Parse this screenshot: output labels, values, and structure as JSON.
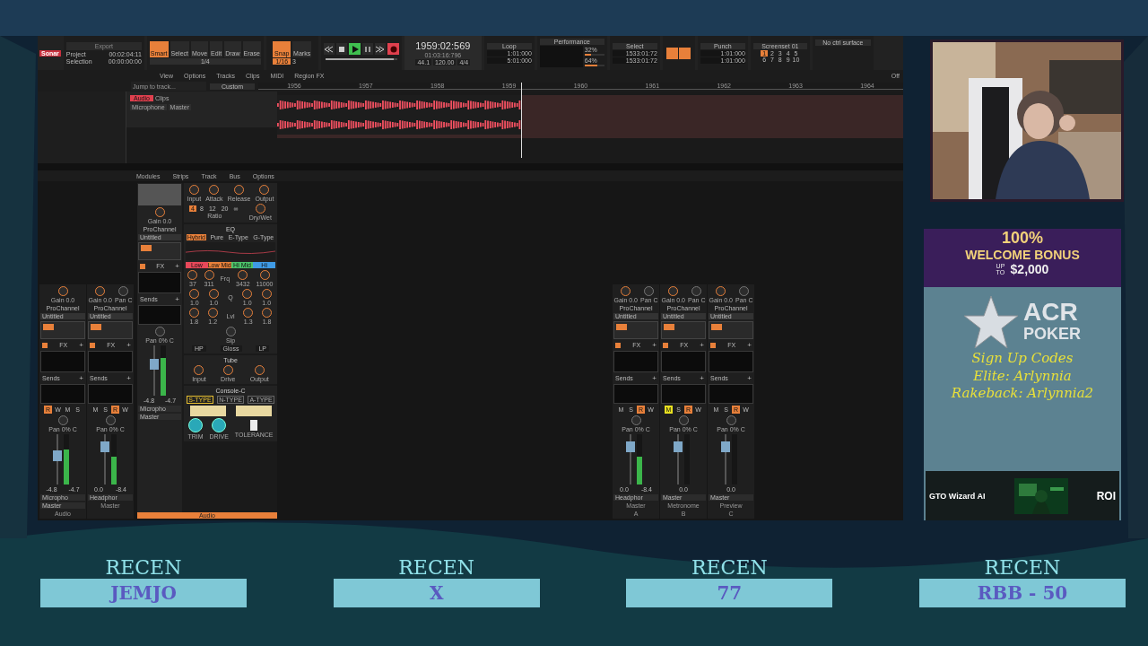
{
  "daw": {
    "app_name": "Sonar",
    "toolbar": {
      "export": "Export",
      "project_label": "Project",
      "project_time": "00:02:04:11",
      "selection_label": "Selection",
      "selection_time": "00:00:00:00",
      "tools": [
        {
          "label": "Smart",
          "selected": true
        },
        {
          "label": "Select",
          "selected": false
        },
        {
          "label": "Move",
          "selected": false
        },
        {
          "label": "Edit",
          "selected": false
        },
        {
          "label": "Draw",
          "selected": false
        },
        {
          "label": "Erase",
          "selected": false
        }
      ],
      "grid": "1/4",
      "snap": {
        "label": "Snap",
        "on": true,
        "value": "1/16"
      },
      "marks": "Marks",
      "marks_value": "3",
      "transport": [
        {
          "kind": "rewind"
        },
        {
          "kind": "stop"
        },
        {
          "kind": "play",
          "on": true
        },
        {
          "kind": "pause"
        },
        {
          "kind": "forward"
        },
        {
          "kind": "record",
          "on": true
        }
      ],
      "position": {
        "level": 0.95
      },
      "time": "1959:02:569",
      "time_sub": "01:03:16:796",
      "counters": [
        "44.1",
        "120.00",
        "4/4"
      ],
      "loop": {
        "title": "Loop",
        "start": "1:01:000",
        "end": "5:01:000"
      },
      "performance": {
        "title": "Performance",
        "meters": [
          {
            "text": "32%",
            "level": 0.32
          },
          {
            "text": "64%",
            "level": 0.64
          }
        ]
      },
      "select": {
        "title": "Select",
        "start": "1533:01:72",
        "end": "1533:01:72"
      },
      "punch": {
        "title": "Punch",
        "start": "1:01:000",
        "end": "1:01:000"
      },
      "screenset": {
        "title": "Screenset 01",
        "slots": [
          {
            "label": "1",
            "selected": true
          },
          {
            "label": "2",
            "selected": false
          },
          {
            "label": "3",
            "selected": false
          },
          {
            "label": "4",
            "selected": false
          },
          {
            "label": "5",
            "selected": false
          },
          {
            "label": "6",
            "selected": false
          },
          {
            "label": "7",
            "selected": false
          },
          {
            "label": "8",
            "selected": false
          },
          {
            "label": "9",
            "selected": false
          },
          {
            "label": "10",
            "selected": false
          }
        ]
      },
      "ctrl_surface": "No ctrl surface"
    },
    "menu": [
      "View",
      "Options",
      "Tracks",
      "Clips",
      "MIDI",
      "Region FX"
    ],
    "jump_placeholder": "Jump to track...",
    "view_preset": "Custom",
    "snap_off": "Off",
    "ruler": [
      "1956",
      "1957",
      "1958",
      "1959",
      "1960",
      "1961",
      "1962",
      "1963",
      "1964"
    ],
    "track": {
      "name": "Audio",
      "clips_label": "Clips",
      "input": "Microphone",
      "output": "Master"
    },
    "console_menu": [
      "Modules",
      "Strips",
      "Track",
      "Bus",
      "Options"
    ],
    "left_strips": [
      {
        "gain": "Gain 0.0",
        "prochannel": "ProChannel",
        "preset": "Untitled",
        "fx": "FX",
        "sends": "Sends",
        "add": "+",
        "buttons": [
          {
            "label": "R",
            "kind": "arm",
            "on": true
          },
          {
            "label": "W",
            "kind": "write",
            "on": false
          },
          {
            "label": "M",
            "kind": "mute",
            "on": false
          },
          {
            "label": "S",
            "kind": "solo",
            "on": false
          }
        ],
        "pan_text": "Pan 0% C",
        "fader": {
          "level": 0.55
        },
        "meter": {
          "level": 0.7
        },
        "readings": [
          "-4.8",
          "-4.7"
        ],
        "input": "Micropho",
        "output": "Master",
        "name": "Audio"
      },
      {
        "gain": "Gain 0.0",
        "pan": "Pan C",
        "prochannel": "ProChannel",
        "preset": "Untitled",
        "fx": "FX",
        "sends": "Sends",
        "add": "+",
        "buttons": [
          {
            "label": "M",
            "kind": "mute",
            "on": false
          },
          {
            "label": "S",
            "kind": "solo",
            "on": false
          },
          {
            "label": "R",
            "kind": "arm",
            "on": true
          },
          {
            "label": "W",
            "kind": "write",
            "on": false
          }
        ],
        "pan_text": "Pan 0% C",
        "fader": {
          "level": 0.75
        },
        "meter": {
          "level": 0.55
        },
        "readings": [
          "0.0",
          "-8.4"
        ],
        "output": "Headphor",
        "name": "Master"
      }
    ],
    "inspector": {
      "comp_knobs": [
        "Input",
        "Attack",
        "Release",
        "Output"
      ],
      "ratios": [
        {
          "label": "4",
          "selected": true
        },
        {
          "label": "8",
          "selected": false
        },
        {
          "label": "12",
          "selected": false
        },
        {
          "label": "20",
          "selected": false
        },
        {
          "label": "∞",
          "selected": false
        }
      ],
      "ratio_label": "Ratio",
      "drywet": "Dry/Wet",
      "gain": "Gain 0.0",
      "prochannel": "ProChannel",
      "preset": "Untitled",
      "fx": "FX",
      "sends": "Sends",
      "add": "+",
      "pan_text": "Pan 0% C",
      "eq_title": "EQ",
      "eq_types": [
        {
          "label": "Hybrid",
          "selected": true
        },
        {
          "label": "Pure",
          "selected": false
        },
        {
          "label": "E-Type",
          "selected": false
        },
        {
          "label": "G-Type",
          "selected": false
        }
      ],
      "bands": [
        {
          "label": "Low",
          "color": "#e8485a"
        },
        {
          "label": "Low Mid",
          "color": "#e8803a"
        },
        {
          "label": "Hi Mid",
          "color": "#4cc36a"
        },
        {
          "label": "Hi",
          "color": "#3f9be6"
        }
      ],
      "rows": [
        {
          "label": "Frq",
          "values": [
            "37",
            "311",
            "3432",
            "11000"
          ]
        },
        {
          "label": "Q",
          "values": [
            "1.0",
            "1.0",
            "1.0",
            "1.0"
          ]
        },
        {
          "label": "Lvl",
          "values": [
            "1.8",
            "1.2",
            "1.3",
            "1.8"
          ]
        }
      ],
      "slope": "Slp",
      "filters": [
        "HP",
        "Gloss",
        "LP"
      ],
      "tube_title": "Tube",
      "tube_knobs": [
        "Input",
        "Drive",
        "Output"
      ],
      "console_title": "Console-C",
      "console_types": [
        {
          "label": "S-TYPE",
          "selected": true
        },
        {
          "label": "N-TYPE",
          "selected": false
        },
        {
          "label": "A-TYPE",
          "selected": false
        }
      ],
      "console_knobs": [
        "TRIM",
        "DRIVE",
        "TOLERANCE"
      ],
      "console_switch": {
        "on": true
      },
      "fader": {
        "level": 0.6
      },
      "meter": {
        "level": 0.75
      },
      "readings": [
        "-4.8",
        "-4.7"
      ],
      "input": "Micropho",
      "output": "Master",
      "name": "Audio"
    },
    "right_strips": [
      {
        "gain": "Gain 0.0",
        "pan": "Pan C",
        "prochannel": "ProChannel",
        "preset": "Untitled",
        "fx": "FX",
        "sends": "Sends",
        "add": "+",
        "buttons": [
          {
            "label": "M",
            "kind": "mute",
            "on": false
          },
          {
            "label": "S",
            "kind": "solo",
            "on": false
          },
          {
            "label": "R",
            "kind": "arm",
            "on": true
          },
          {
            "label": "W",
            "kind": "write",
            "on": false
          }
        ],
        "pan_text": "Pan 0% C",
        "fader": {
          "level": 0.75
        },
        "meter": {
          "level": 0.55
        },
        "readings": [
          "0.0",
          "-8.4"
        ],
        "output": "Headphor",
        "name": "Master",
        "letter": "A"
      },
      {
        "gain": "Gain 0.0",
        "pan": "Pan C",
        "prochannel": "ProChannel",
        "preset": "Untitled",
        "fx": "FX",
        "sends": "Sends",
        "add": "+",
        "buttons": [
          {
            "label": "M",
            "kind": "mute",
            "on": true
          },
          {
            "label": "S",
            "kind": "solo",
            "on": false
          },
          {
            "label": "R",
            "kind": "arm",
            "on": true
          },
          {
            "label": "W",
            "kind": "write",
            "on": false
          }
        ],
        "pan_text": "Pan 0% C",
        "fader": {
          "level": 0.75
        },
        "meter": {
          "level": 0
        },
        "readings": [
          "0.0"
        ],
        "output": "Master",
        "name": "Metronome",
        "letter": "B"
      },
      {
        "gain": "Gain 0.0",
        "pan": "Pan C",
        "prochannel": "ProChannel",
        "preset": "Untitled",
        "fx": "FX",
        "sends": "Sends",
        "add": "+",
        "buttons": [
          {
            "label": "M",
            "kind": "mute",
            "on": false
          },
          {
            "label": "S",
            "kind": "solo",
            "on": false
          },
          {
            "label": "R",
            "kind": "arm",
            "on": true
          },
          {
            "label": "W",
            "kind": "write",
            "on": false
          }
        ],
        "pan_text": "Pan 0% C",
        "fader": {
          "level": 0.75
        },
        "meter": {
          "level": 0
        },
        "readings": [
          "0.0"
        ],
        "output": "Master",
        "name": "Preview",
        "letter": "C"
      }
    ]
  },
  "ad": {
    "banner": {
      "big": "100%",
      "line": "WELCOME BONUS",
      "small": "UP TO",
      "amount": "$2,000"
    },
    "brand": [
      "ACR",
      "POKER"
    ],
    "codes": [
      "Sign Up Codes",
      "Elite: Arlynnia",
      "Rakeback: Arlynnia2"
    ],
    "promo": {
      "title": "GTO Wizard AI",
      "badge": "ROI"
    }
  },
  "recent": [
    {
      "title": "RECEN",
      "name": "JEMJO"
    },
    {
      "title": "RECEN",
      "name": "X"
    },
    {
      "title": "RECEN",
      "name": "77"
    },
    {
      "title": "RECEN",
      "name": "RBB - 50"
    }
  ]
}
